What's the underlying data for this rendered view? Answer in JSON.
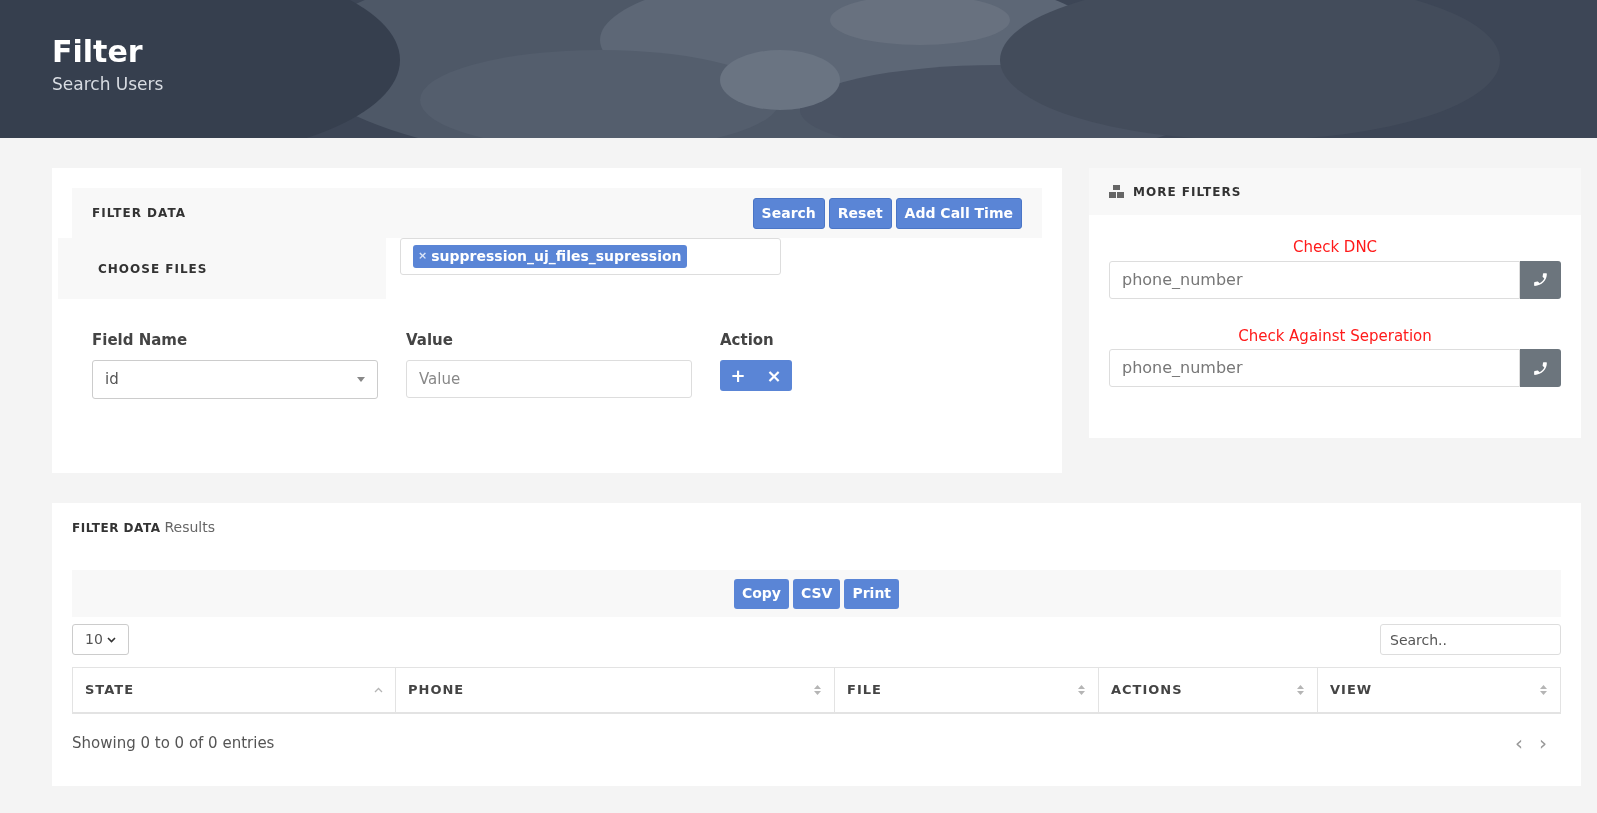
{
  "header": {
    "title": "Filter",
    "subtitle": "Search Users"
  },
  "filter_card": {
    "title": "FILTER DATA",
    "buttons": [
      "Search",
      "Reset",
      "Add Call Time"
    ],
    "choose_files_label": "CHOOSE FILES",
    "selected_files": [
      {
        "label": "suppression_uj_files_supression",
        "remove": "×"
      }
    ],
    "field_name": {
      "label": "Field Name",
      "value": "id"
    },
    "value": {
      "label": "Value",
      "placeholder": "Value"
    },
    "action": {
      "label": "Action",
      "buttons": [
        "+",
        "×"
      ]
    }
  },
  "more_filters": {
    "title": "MORE FILTERS",
    "checks": [
      {
        "label": "Check DNC",
        "placeholder": "phone_number"
      },
      {
        "label": "Check Against Seperation",
        "placeholder": "phone_number"
      }
    ]
  },
  "results": {
    "title": "FILTER DATA",
    "subtitle": "Results",
    "export_buttons": [
      "Copy",
      "CSV",
      "Print"
    ],
    "page_size": "10",
    "search_placeholder": "Search..",
    "columns": [
      {
        "label": "STATE",
        "sorted": true
      },
      {
        "label": "PHONE",
        "sorted": false
      },
      {
        "label": "FILE",
        "sorted": false
      },
      {
        "label": "ACTIONS",
        "sorted": false
      },
      {
        "label": "VIEW",
        "sorted": false
      }
    ],
    "info": "Showing 0 to 0 of 0 entries",
    "pager": [
      "‹",
      "›"
    ]
  }
}
